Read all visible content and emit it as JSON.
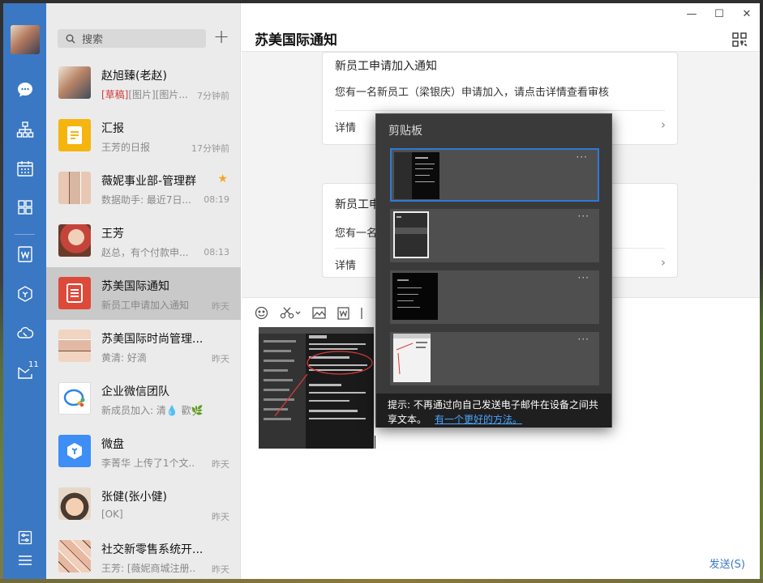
{
  "nav": {
    "avatar_icon": "user-avatar",
    "items": [
      {
        "icon": "chat-bubble-icon"
      },
      {
        "icon": "org-chart-icon"
      },
      {
        "icon": "calendar-icon"
      },
      {
        "icon": "apps-grid-icon"
      },
      {
        "icon": "document-w-icon"
      },
      {
        "icon": "cube-icon"
      },
      {
        "icon": "cloud-phone-icon"
      },
      {
        "icon": "inbox-icon",
        "badge": "11"
      },
      {
        "icon": "settings-sliders-icon"
      },
      {
        "icon": "menu-icon"
      }
    ]
  },
  "search": {
    "placeholder": "搜索"
  },
  "chats": [
    {
      "name": "赵旭臻(老赵)",
      "draft": "[草稿]",
      "sub": "[图片][图片...",
      "time": "7分钟前"
    },
    {
      "name": "汇报",
      "draft": "",
      "sub": "王芳的日报",
      "time": "17分钟前"
    },
    {
      "name": "薇妮事业部-管理群",
      "draft": "",
      "sub": "数据助手: 最近7日...",
      "time": "08:19",
      "starred": true
    },
    {
      "name": "王芳",
      "draft": "",
      "sub": "赵总，有个付款申...",
      "time": "08:13"
    },
    {
      "name": "苏美国际通知",
      "draft": "",
      "sub": "新员工申请加入通知",
      "time": "昨天",
      "selected": true
    },
    {
      "name": "苏美国际时尚管理...",
      "draft": "",
      "sub": "黄清: 好滴",
      "time": "昨天"
    },
    {
      "name": "企业微信团队",
      "draft": "",
      "sub": "新成员加入: 清💧 歡🌿",
      "time": ""
    },
    {
      "name": "微盘",
      "draft": "",
      "sub": "李菁华 上传了1个文...",
      "time": "昨天"
    },
    {
      "name": "张健(张小健)",
      "draft": "",
      "sub": "[OK]",
      "time": "昨天"
    },
    {
      "name": "社交新零售系统开...",
      "draft": "",
      "sub": "王芳: [薇妮商城注册...",
      "time": "昨天"
    }
  ],
  "window": {
    "minimize": "—",
    "maximize": "☐",
    "close": "✕"
  },
  "main": {
    "title": "苏美国际通知",
    "cards": [
      {
        "title": "新员工申请加入通知",
        "body": "您有一名新员工（梁银庆）申请加入，请点击详情查看审核",
        "detail": "详情"
      },
      {
        "title": "新员工申",
        "body": "您有一名",
        "detail": "详情"
      }
    ],
    "send_label": "发送(S)"
  },
  "clipboard": {
    "header": "剪贴板",
    "entry_menu": "···",
    "hint_text": "提示: 不再通过向自己发送电子邮件在设备之间共享文本。",
    "hint_link": "有一个更好的方法。"
  },
  "colors": {
    "sidebar": "#3b78c4",
    "accent": "#3b78c4",
    "clipboard_bg": "#3a3a3a",
    "selected_border": "#2d7ad6"
  }
}
